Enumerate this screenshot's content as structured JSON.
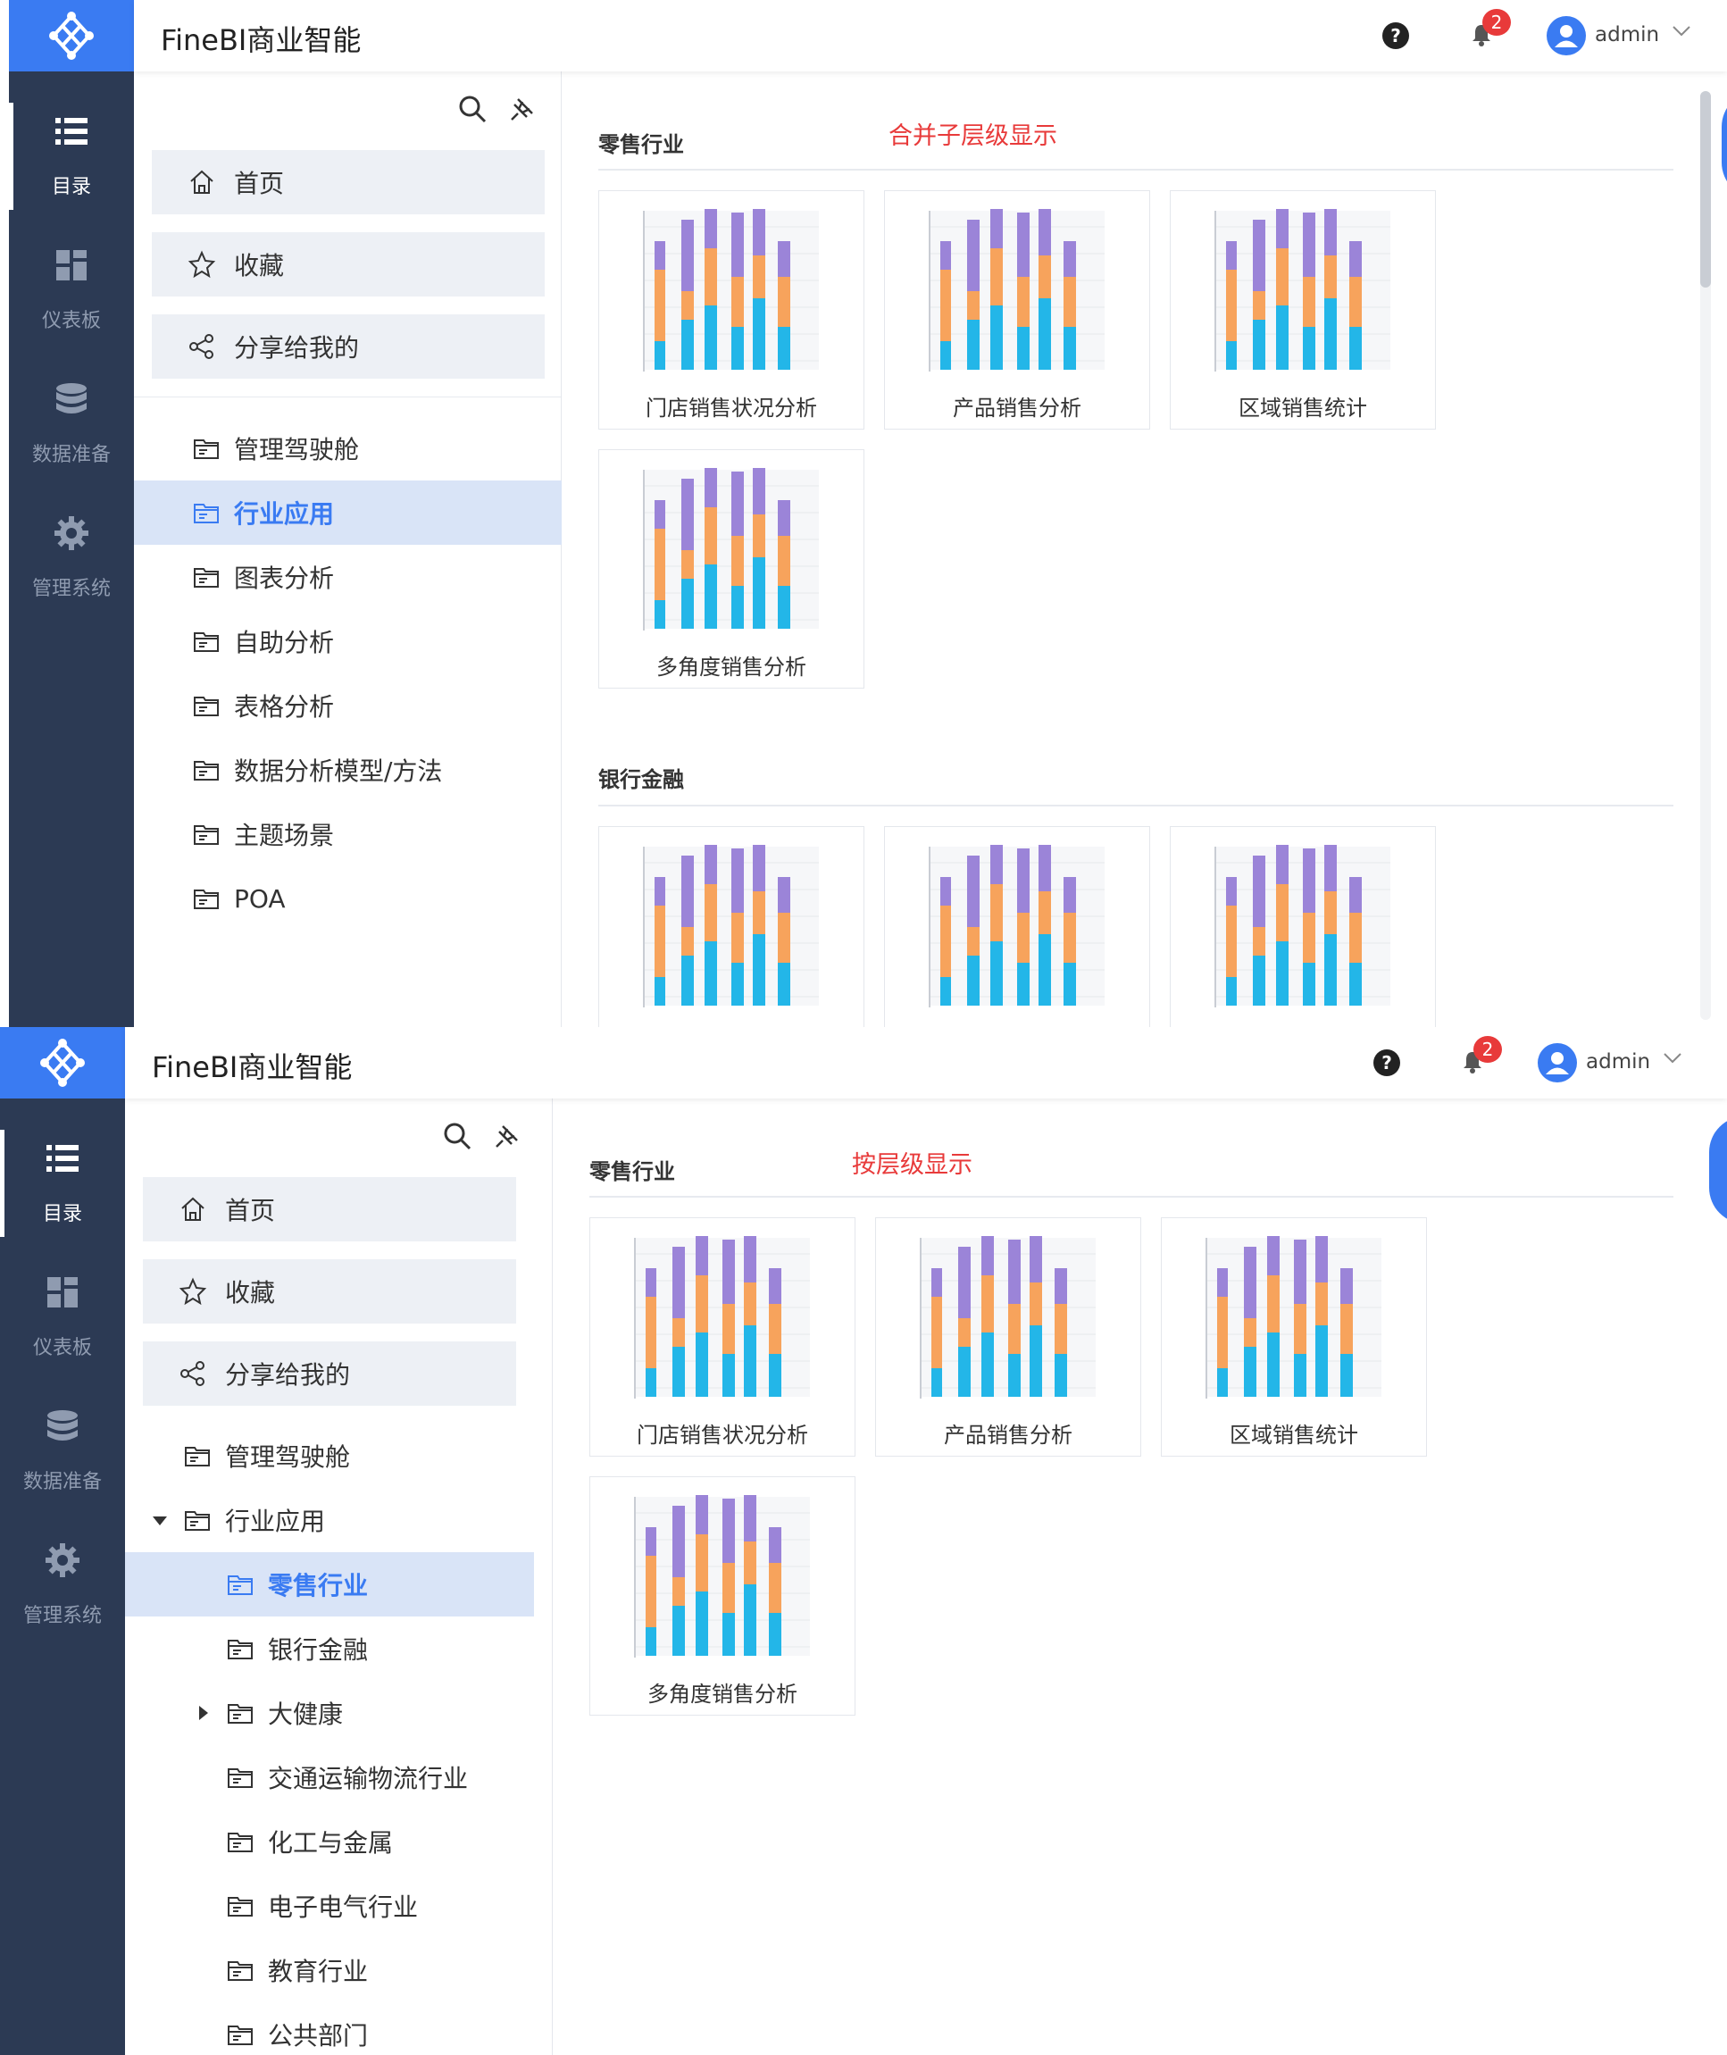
{
  "app": {
    "title": "FineBI商业智能"
  },
  "colors": {
    "accent": "#3a7bf2",
    "sidebar_bg": "#2c3a54",
    "annotation": "#e83a3a",
    "bar_cyan": "#23b6e8",
    "bar_orange": "#f7a35c",
    "bar_purple": "#9b84d8"
  },
  "header": {
    "help_icon": "help-icon",
    "notification_count": "2",
    "user": "admin"
  },
  "sidebar": {
    "items": [
      {
        "label": "目录",
        "icon": "catalog-icon"
      },
      {
        "label": "仪表板",
        "icon": "dashboard-icon"
      },
      {
        "label": "数据准备",
        "icon": "database-icon"
      },
      {
        "label": "管理系统",
        "icon": "gear-icon"
      }
    ]
  },
  "nav": {
    "quick_links": [
      {
        "label": "首页",
        "icon": "home-icon"
      },
      {
        "label": "收藏",
        "icon": "star-icon"
      },
      {
        "label": "分享给我的",
        "icon": "share-icon"
      }
    ]
  },
  "screen1": {
    "annotation": "合并子层级显示",
    "tree": [
      "管理驾驶舱",
      "行业应用",
      "图表分析",
      "自助分析",
      "表格分析",
      "数据分析模型/方法",
      "主题场景",
      "POA"
    ],
    "selected": "行业应用",
    "sections": [
      {
        "title": "零售行业",
        "cards": [
          "门店销售状况分析",
          "产品销售分析",
          "区域销售统计",
          "多角度销售分析"
        ]
      },
      {
        "title": "银行金融"
      }
    ]
  },
  "screen2": {
    "annotation": "按层级显示",
    "tree": [
      {
        "label": "管理驾驶舱",
        "level": 0
      },
      {
        "label": "行业应用",
        "level": 0,
        "expanded": true
      },
      {
        "label": "零售行业",
        "level": 1,
        "selected": true
      },
      {
        "label": "银行金融",
        "level": 1
      },
      {
        "label": "大健康",
        "level": 1,
        "collapsed": true
      },
      {
        "label": "交通运输物流行业",
        "level": 1
      },
      {
        "label": "化工与金属",
        "level": 1
      },
      {
        "label": "电子电气行业",
        "level": 1
      },
      {
        "label": "教育行业",
        "level": 1
      },
      {
        "label": "公共部门",
        "level": 1
      }
    ],
    "sections": [
      {
        "title": "零售行业",
        "cards": [
          "门店销售状况分析",
          "产品销售分析",
          "区域销售统计",
          "多角度销售分析"
        ]
      }
    ]
  },
  "thumbnail_bars": {
    "cyan": [
      2,
      3.5,
      4.5,
      3,
      5,
      3
    ],
    "orange": [
      5,
      2,
      4,
      3.5,
      3,
      3.5
    ],
    "purple": [
      2,
      5,
      6.5,
      4.5,
      3.5,
      2.5
    ]
  }
}
